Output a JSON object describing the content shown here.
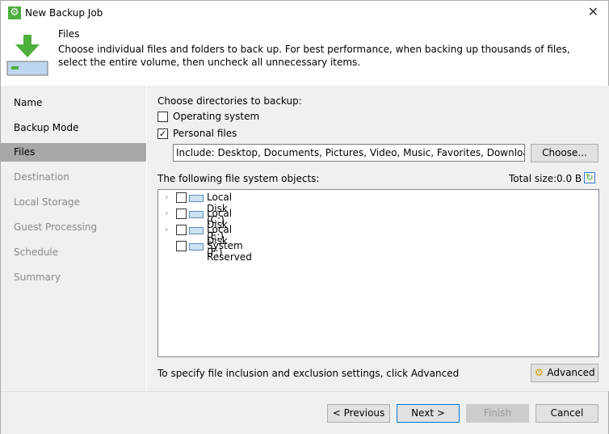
{
  "window": {
    "title": "New Backup Job",
    "close": "✕"
  },
  "header": {
    "title": "Files",
    "description": "Choose individual files and folders to back up. For best performance, when backing up thousands of files, select the entire volume, then uncheck all unnecessary items."
  },
  "sidebar": {
    "items": [
      {
        "label": "Name"
      },
      {
        "label": "Backup Mode"
      },
      {
        "label": "Files"
      },
      {
        "label": "Destination"
      },
      {
        "label": "Local Storage"
      },
      {
        "label": "Guest Processing"
      },
      {
        "label": "Schedule"
      },
      {
        "label": "Summary"
      }
    ]
  },
  "main": {
    "choose_label": "Choose directories to backup:",
    "os_label": "Operating system",
    "os_checked": false,
    "personal_label": "Personal files",
    "personal_checked": true,
    "include_value": "Include: Desktop, Documents, Pictures, Video, Music, Favorites, Downloads, Other",
    "choose_button": "Choose...",
    "objects_label": "The following file system objects:",
    "total_size_label": "Total size:",
    "total_size_value": "0.0 B",
    "tree": [
      {
        "label": "Local Disk (C:)"
      },
      {
        "label": "Local Disk (E:)"
      },
      {
        "label": "Local Disk (F:)"
      },
      {
        "label": "System Reserved"
      }
    ],
    "hint": "To specify file inclusion and exclusion settings, click Advanced",
    "advanced_button": "Advanced"
  },
  "footer": {
    "previous": "< Previous",
    "next": "Next >",
    "finish": "Finish",
    "cancel": "Cancel"
  }
}
